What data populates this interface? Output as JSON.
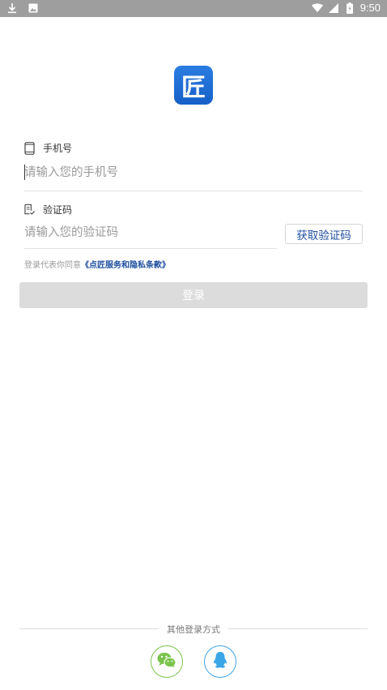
{
  "status_bar": {
    "time": "9:50",
    "left_icons": [
      "download-icon",
      "image-icon"
    ],
    "right_icons": [
      "wifi-icon",
      "signal-icon",
      "battery-icon"
    ]
  },
  "logo": {
    "glyph": "匠",
    "color": "#1e6fd9"
  },
  "phone": {
    "label": "手机号",
    "icon": "phone-icon",
    "placeholder": "请输入您的手机号",
    "value": ""
  },
  "code": {
    "label": "验证码",
    "icon": "verify-code-icon",
    "placeholder": "请输入您的验证码",
    "value": "",
    "get_code_label": "获取验证码"
  },
  "agreement": {
    "prefix": "登录代表你同意",
    "link": "《点匠服务和隐私条款》"
  },
  "login_button": {
    "label": "登录"
  },
  "other_login": {
    "title": "其他登录方式",
    "options": [
      {
        "name": "wechat",
        "icon": "wechat-icon",
        "color": "#7ac34a"
      },
      {
        "name": "qq",
        "icon": "qq-icon",
        "color": "#3aa6e8"
      }
    ]
  },
  "colors": {
    "accent": "#1f4fa0",
    "disabled_button": "#dcdcdc",
    "status_bar": "#9e9e9e"
  }
}
